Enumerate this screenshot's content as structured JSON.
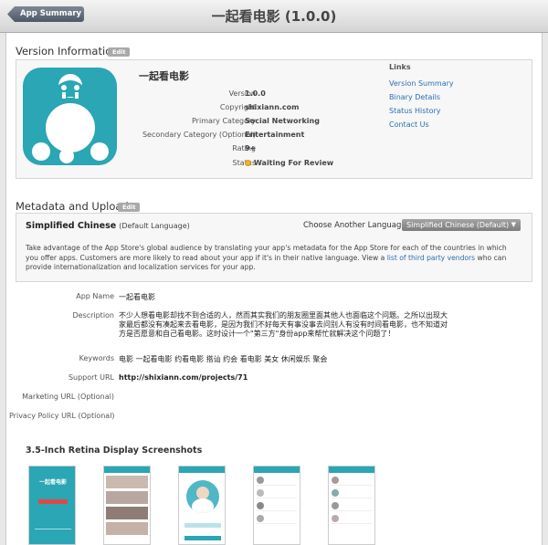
{
  "header": {
    "back_label": "App Summary",
    "title": "一起看电影 (1.0.0)"
  },
  "version_info": {
    "section_title": "Version Information",
    "edit_label": "Edit",
    "app_name": "一起看电影",
    "rows": [
      {
        "label": "Version",
        "value": "1.0.0"
      },
      {
        "label": "Copyright",
        "value": "shixiann.com"
      },
      {
        "label": "Primary Category",
        "value": "Social Networking"
      },
      {
        "label": "Secondary Category (Optional)",
        "value": "Entertainment"
      },
      {
        "label": "Rating",
        "value": "9+"
      },
      {
        "label": "Status",
        "value": "Waiting For Review"
      }
    ],
    "status_color": "#f0b429",
    "icon_color": "#2aa6b4",
    "icon_name": "app-icon"
  },
  "links": {
    "title": "Links",
    "items": [
      "Version Summary",
      "Binary Details",
      "Status History",
      "Contact Us"
    ]
  },
  "metadata": {
    "section_title": "Metadata and Uploads",
    "edit_label": "Edit",
    "language_name": "Simplified Chinese",
    "language_note": "(Default Language)",
    "choose_label": "Choose Another Language:",
    "selected_language": "Simplified Chinese (Default)",
    "intro_text": "Take advantage of the App Store's global audience by translating your app's metadata for the App Store for each of the countries in which you offer apps. Customers are more likely to read about your app if it's in their native language. View a ",
    "intro_link": "list of third party vendors",
    "intro_tail": " who can provide internationalization and localization services for your app.",
    "fields": {
      "app_name_label": "App Name",
      "app_name_value": "一起看电影",
      "description_label": "Description",
      "description_value": "不少人想看电影却找不到合适的人，然而其实我们的朋友圈里面其他人也面临这个问题。之所以出现大家最后都没有凑起来去看电影，是因为我们不好每天有事没事去问别人有没有时间看电影，也不知道对方是否愿意和自己看电影。这时设计一个\"第三方\"身份app来帮忙就解决这个问题了！",
      "keywords_label": "Keywords",
      "keywords_value": "电影 一起看电影 约看电影 搭讪 约会 看电影 美女 休闲娱乐 聚会",
      "support_url_label": "Support URL",
      "support_url_value": "http://shixiann.com/projects/71",
      "marketing_url_label": "Marketing URL (Optional)",
      "privacy_url_label": "Privacy Policy URL (Optional)"
    },
    "screenshots_title": "3.5-Inch Retina Display Screenshots",
    "splash_title": "一起看电影"
  }
}
